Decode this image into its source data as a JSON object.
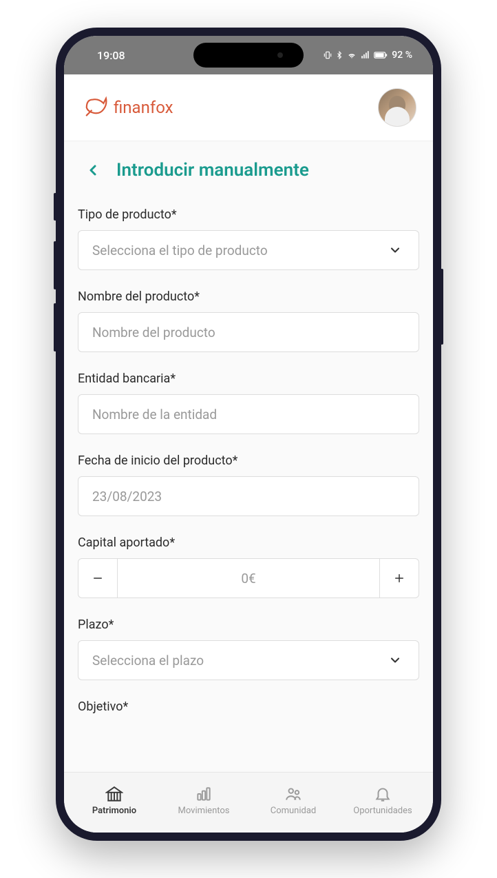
{
  "status": {
    "time": "19:08",
    "battery": "92 %"
  },
  "header": {
    "brand": "finanfox"
  },
  "page": {
    "title": "Introducir manualmente"
  },
  "form": {
    "product_type": {
      "label": "Tipo de producto*",
      "placeholder": "Selecciona el tipo de producto"
    },
    "product_name": {
      "label": "Nombre del producto*",
      "placeholder": "Nombre del producto"
    },
    "bank_entity": {
      "label": "Entidad bancaria*",
      "placeholder": "Nombre de la entidad"
    },
    "start_date": {
      "label": "Fecha de inicio del producto*",
      "value": "23/08/2023"
    },
    "capital": {
      "label": "Capital aportado*",
      "value": "0€"
    },
    "term": {
      "label": "Plazo*",
      "placeholder": "Selecciona el plazo"
    },
    "objective": {
      "label": "Objetivo*"
    }
  },
  "nav": {
    "patrimonio": "Patrimonio",
    "movimientos": "Movimientos",
    "comunidad": "Comunidad",
    "oportunidades": "Oportunidades"
  }
}
